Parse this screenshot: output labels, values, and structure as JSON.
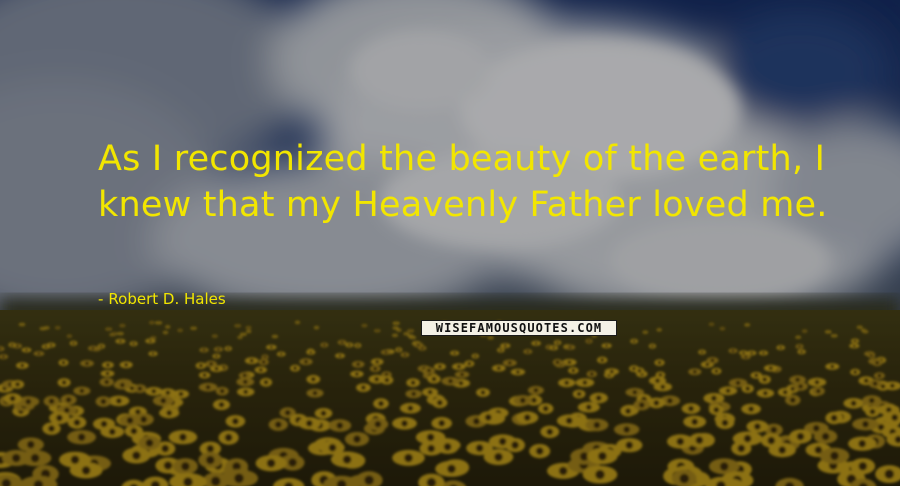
{
  "quote": {
    "text": "As I recognized the beauty of the earth, I knew that my Heavenly Father loved me.",
    "author": "Robert D. Hales",
    "dash": "-"
  },
  "watermark": {
    "text": "WISEFAMOUSQUOTES.COM"
  },
  "colors": {
    "text": "#f2e600",
    "sky": "#1e3566",
    "cloud": "#e6e8ec",
    "field": "#3a3410",
    "flower": "#c8a21a"
  }
}
